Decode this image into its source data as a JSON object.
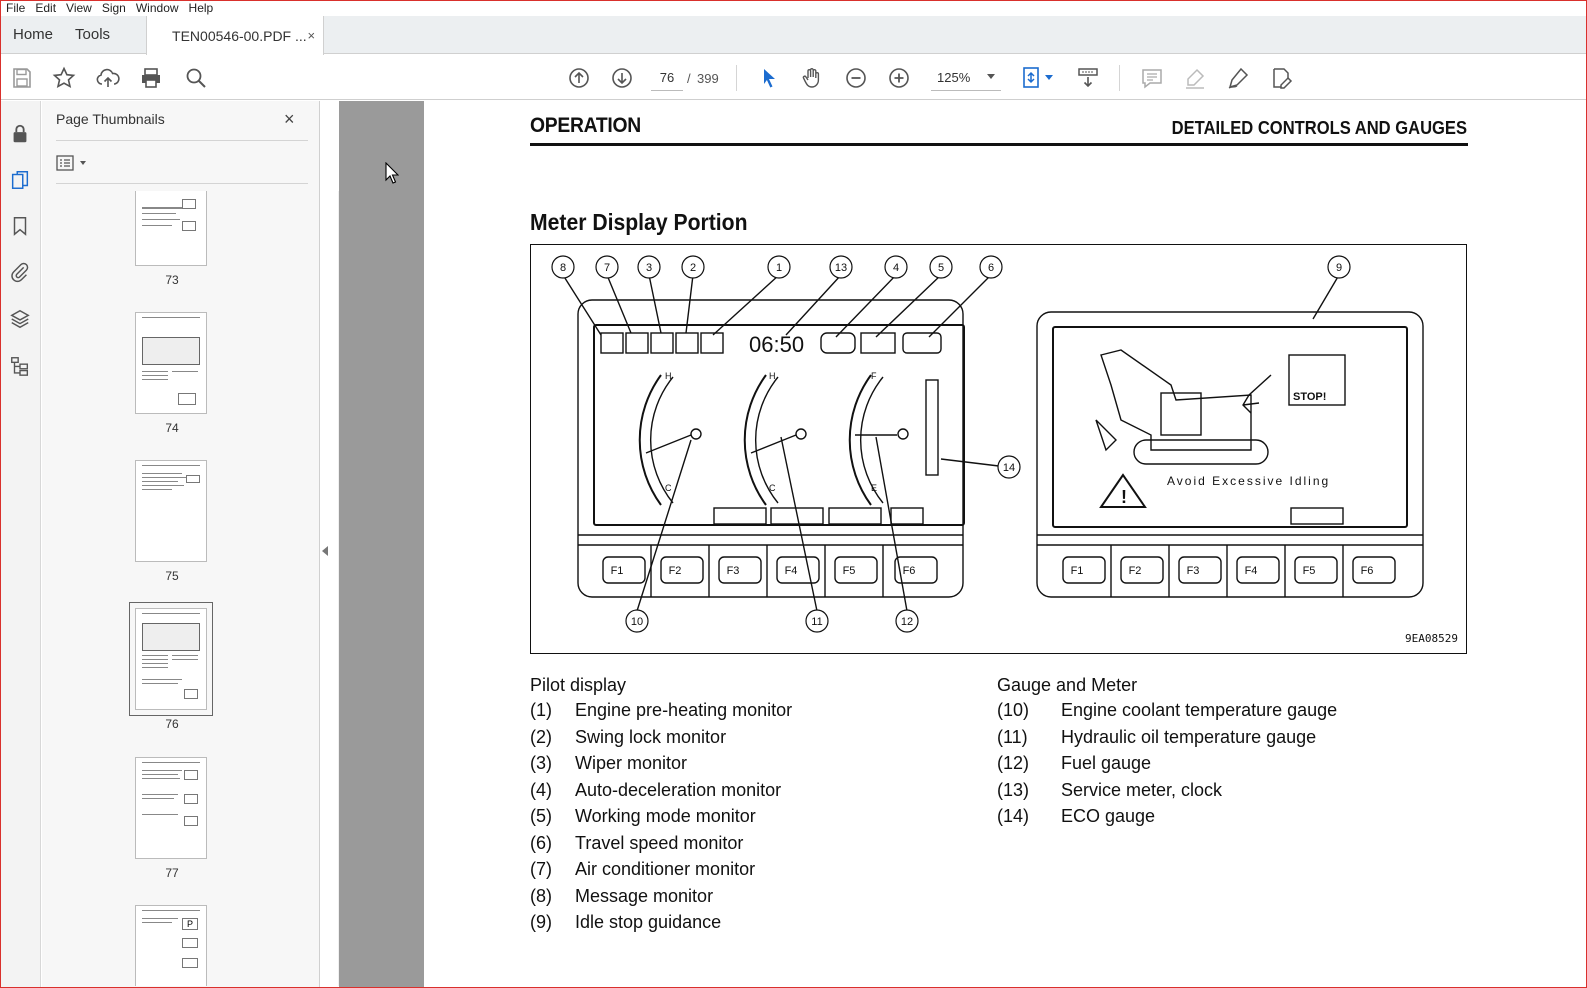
{
  "menu": [
    "File",
    "Edit",
    "View",
    "Sign",
    "Window",
    "Help"
  ],
  "tabs": {
    "home": "Home",
    "tools": "Tools",
    "document": "TEN00546-00.PDF ...",
    "close": "×"
  },
  "toolbar": {
    "page_current": "76",
    "page_sep": "/",
    "page_total": "399",
    "zoom": "125%"
  },
  "panel": {
    "title": "Page Thumbnails",
    "close": "×",
    "thumbnails": [
      {
        "label": "73"
      },
      {
        "label": "74"
      },
      {
        "label": "75"
      },
      {
        "label": "76",
        "active": true
      },
      {
        "label": "77"
      }
    ]
  },
  "page": {
    "header_left": "OPERATION",
    "header_right": "DETAILED CONTROLS AND GAUGES",
    "section_title": "Meter Display Portion",
    "figure_id": "9EA08529",
    "figure": {
      "clock": "06:50",
      "message": "Avoid Excessive Idling",
      "stop": "STOP!",
      "gauge_labels": [
        "H",
        "C",
        "H",
        "C",
        "F",
        "E"
      ],
      "fkeys": [
        "F1",
        "F2",
        "F3",
        "F4",
        "F5",
        "F6"
      ],
      "callouts": [
        "8",
        "7",
        "3",
        "2",
        "1",
        "13",
        "4",
        "5",
        "6",
        "9",
        "14",
        "10",
        "11",
        "12"
      ]
    },
    "left_column": {
      "title": "Pilot display",
      "items": [
        {
          "num": "(1)",
          "label": "Engine pre-heating monitor"
        },
        {
          "num": "(2)",
          "label": "Swing lock monitor"
        },
        {
          "num": "(3)",
          "label": "Wiper monitor"
        },
        {
          "num": "(4)",
          "label": "Auto-deceleration monitor"
        },
        {
          "num": "(5)",
          "label": "Working mode monitor"
        },
        {
          "num": "(6)",
          "label": "Travel speed monitor"
        },
        {
          "num": "(7)",
          "label": "Air conditioner monitor"
        },
        {
          "num": "(8)",
          "label": "Message monitor"
        },
        {
          "num": "(9)",
          "label": "Idle stop guidance"
        }
      ]
    },
    "right_column": {
      "title": "Gauge and Meter",
      "items": [
        {
          "num": "(10)",
          "label": "Engine coolant temperature gauge"
        },
        {
          "num": "(11)",
          "label": "Hydraulic oil temperature gauge"
        },
        {
          "num": "(12)",
          "label": "Fuel gauge"
        },
        {
          "num": "(13)",
          "label": "Service meter, clock"
        },
        {
          "num": "(14)",
          "label": "ECO gauge"
        }
      ]
    }
  },
  "colors": {
    "window_border": "#d9302c",
    "selection_blue": "#1c6ccf",
    "doc_background": "#9a9a9a"
  }
}
